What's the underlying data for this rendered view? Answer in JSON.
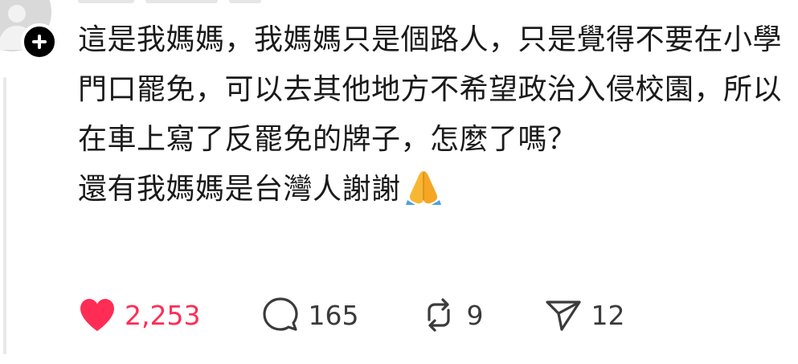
{
  "post": {
    "lines": [
      "這是我媽媽，我媽媽只是個路人，只是覺得不要在小學門口罷免，可以去其他地方不希望政治入侵校園，所以在車上寫了反罷免的牌子，怎麼了嗎？",
      "還有我媽媽是台灣人謝謝"
    ],
    "emoji": "folded-hands"
  },
  "actions": {
    "likes": "2,253",
    "comments": "165",
    "reposts": "9",
    "shares": "12",
    "colors": {
      "like": "#ff2d55",
      "icon": "#3b3b3b"
    }
  }
}
